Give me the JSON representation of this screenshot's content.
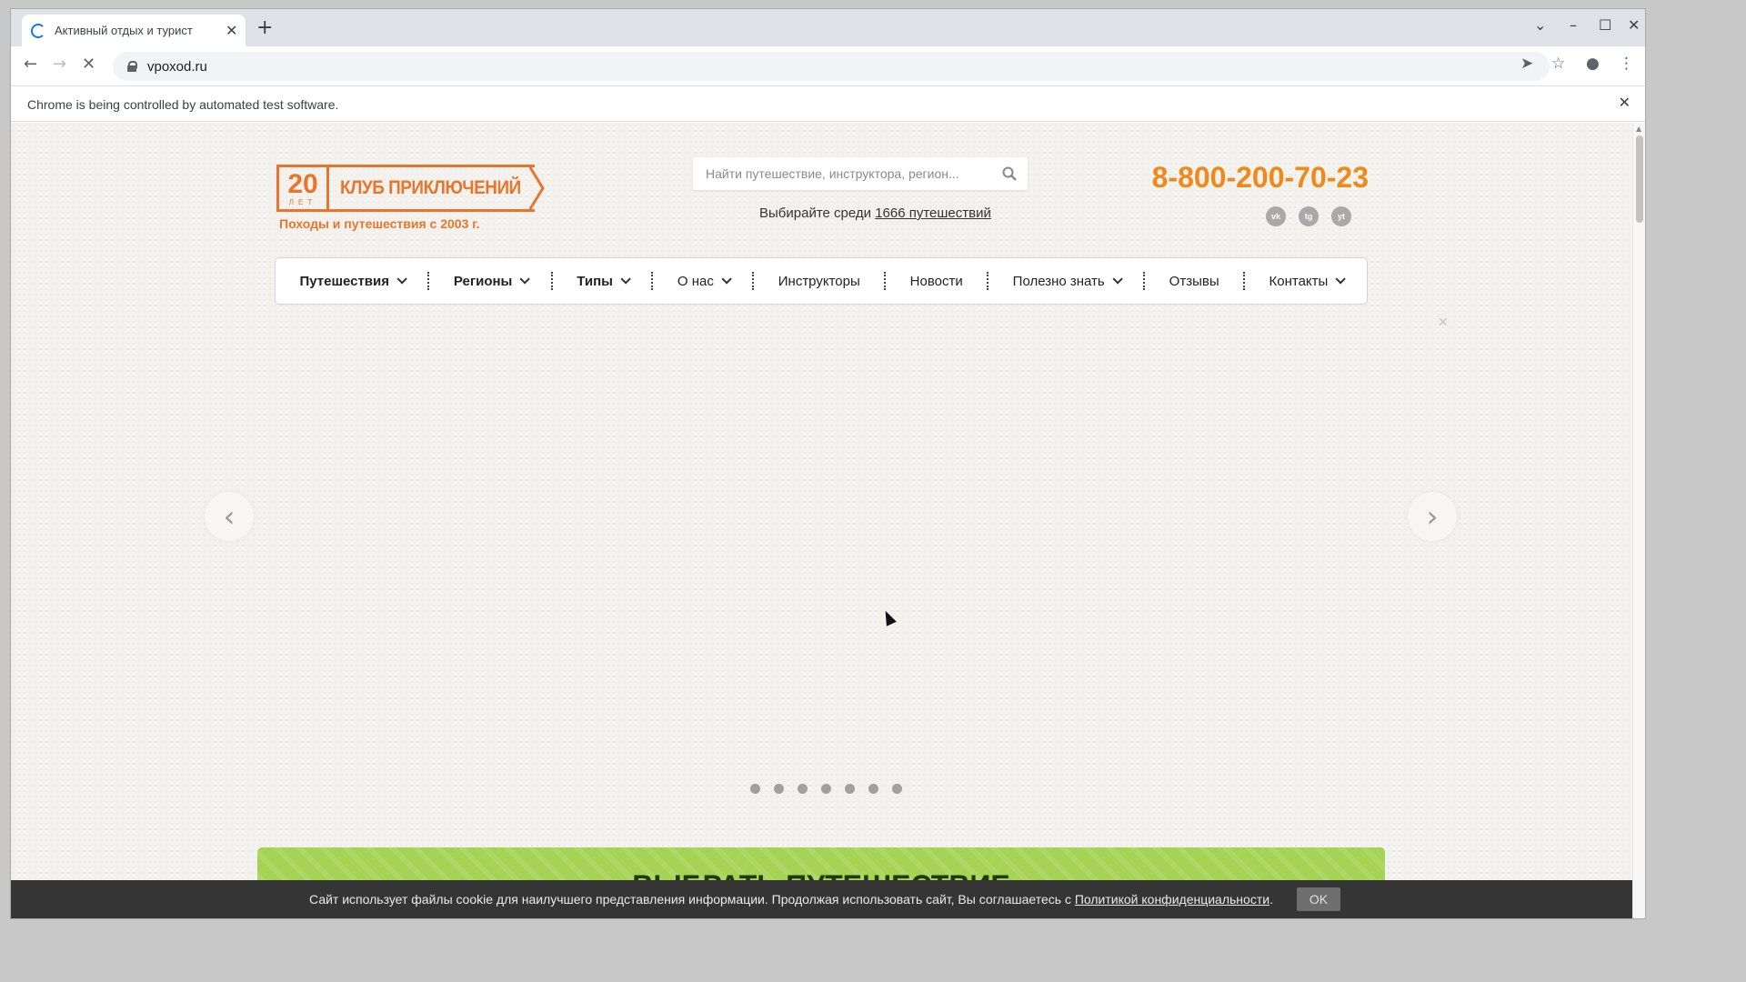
{
  "browser": {
    "tab_title": "Активный отдых и турист",
    "new_tab_symbol": "+",
    "url": "vpoxod.ru",
    "infobar_text": "Chrome is being controlled by automated test software."
  },
  "site": {
    "logo": {
      "years_number": "20",
      "years_label": "ЛЕТ",
      "club_name": "КЛУБ ПРИКЛЮЧЕНИЙ"
    },
    "slogan": "Походы и путешествия с 2003 г.",
    "search": {
      "placeholder": "Найти путешествие, инструктора, регион..."
    },
    "count_prefix": "Выбирайте среди ",
    "count_link": "1666 путешествий",
    "phone": "8-800-200-70-23",
    "socials": [
      {
        "icon": "vk-icon",
        "label": "vk"
      },
      {
        "icon": "telegram-icon",
        "label": "tg"
      },
      {
        "icon": "youtube-icon",
        "label": "yt"
      }
    ],
    "nav": {
      "items": [
        {
          "label": "Путешествия",
          "dropdown": true
        },
        {
          "label": "Регионы",
          "dropdown": true
        },
        {
          "label": "Типы",
          "dropdown": true
        },
        {
          "label": "О нас",
          "dropdown": true
        },
        {
          "label": "Инструкторы",
          "dropdown": false
        },
        {
          "label": "Новости",
          "dropdown": false
        },
        {
          "label": "Полезно знать",
          "dropdown": true
        },
        {
          "label": "Отзывы",
          "dropdown": false
        },
        {
          "label": "Контакты",
          "dropdown": true
        }
      ]
    },
    "slider": {
      "dot_count": 7
    },
    "green_banner_title": "ВЫБРАТЬ ПУТЕШЕСТВИЕ",
    "cookie": {
      "text": "Сайт использует файлы cookie для наилучшего представления информации. Продолжая использовать сайт, Вы соглашаетесь с ",
      "link": "Политикой конфиденциальности",
      "suffix": ".",
      "ok": "OK"
    }
  },
  "colors": {
    "brand_orange": "#e8752c",
    "phone_orange": "#ef8a1a",
    "banner_green": "#a6d354",
    "cookie_bg": "#353535"
  }
}
